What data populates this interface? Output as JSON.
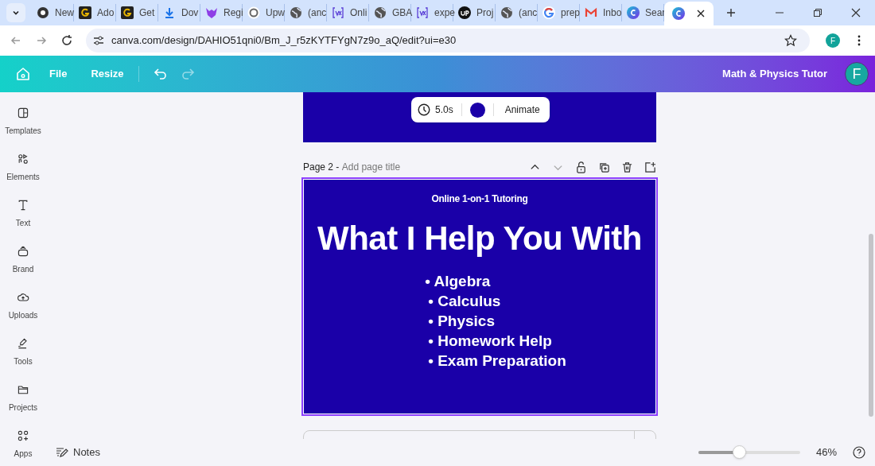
{
  "browser": {
    "tabs": [
      {
        "kind": "chrome",
        "title": "New",
        "selected": false
      },
      {
        "kind": "g-logo",
        "title": "Ado",
        "selected": false
      },
      {
        "kind": "g-logo",
        "title": "Get",
        "selected": false
      },
      {
        "kind": "download",
        "title": "Dov",
        "selected": false
      },
      {
        "kind": "shield",
        "title": "Regi",
        "selected": false
      },
      {
        "kind": "flower",
        "title": "Upw",
        "selected": false
      },
      {
        "kind": "globe",
        "title": "(anc",
        "selected": false
      },
      {
        "kind": "vx",
        "title": "Onli",
        "selected": false
      },
      {
        "kind": "globe",
        "title": "GBA",
        "selected": false
      },
      {
        "kind": "vx",
        "title": "expe",
        "selected": false
      },
      {
        "kind": "up",
        "title": "Proj",
        "selected": false
      },
      {
        "kind": "globe",
        "title": "(anc",
        "selected": false
      },
      {
        "kind": "google",
        "title": "prep",
        "selected": false
      },
      {
        "kind": "gmail",
        "title": "Inbo",
        "selected": false
      },
      {
        "kind": "canva",
        "title": "Sear",
        "selected": false
      },
      {
        "kind": "canva",
        "selected": true
      }
    ],
    "url": "canva.com/design/DAHIO51qni0/Bm_J_r5zKYTFYgN7z9o_aQ/edit?ui=e30",
    "profile": "F"
  },
  "header": {
    "menu": [
      "File",
      "Resize"
    ],
    "design_title": "Math & Physics Tutor",
    "avatar": "F"
  },
  "sidebar": {
    "items": [
      {
        "kind": "templates",
        "label": "Templates"
      },
      {
        "kind": "elements",
        "label": "Elements"
      },
      {
        "kind": "text",
        "label": "Text"
      },
      {
        "kind": "brand",
        "label": "Brand"
      },
      {
        "kind": "uploads",
        "label": "Uploads"
      },
      {
        "kind": "tools",
        "label": "Tools"
      },
      {
        "kind": "projects",
        "label": "Projects"
      },
      {
        "kind": "apps",
        "label": "Apps"
      }
    ]
  },
  "page_toolbar": {
    "duration": "5.0s",
    "color": "#1a00a8",
    "animate": "Animate"
  },
  "page2": {
    "label": "Page 2 - ",
    "title_placeholder": "Add page title",
    "subtitle": "Online 1-on-1 Tutoring",
    "heading": "What I Help You With",
    "bullets": [
      "• Algebra",
      "• Calculus",
      "• Physics",
      "• Homework Help",
      "• Exam Preparation"
    ]
  },
  "footer": {
    "notes": "Notes",
    "zoom": {
      "level": 0.4
    },
    "zoom_reading": "46%"
  }
}
